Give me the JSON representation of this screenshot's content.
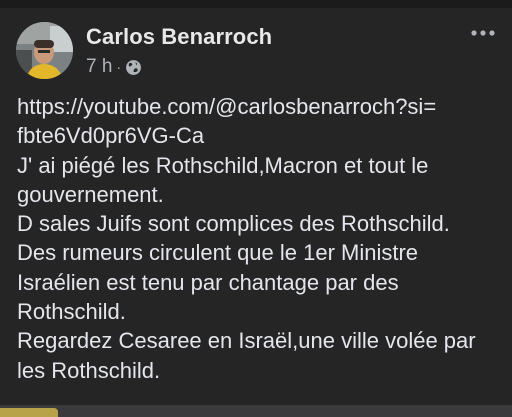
{
  "post": {
    "author": "Carlos Benarroch",
    "time": "7 h",
    "separator": "·",
    "audience_icon": "globe-icon",
    "more_icon": "more-options-icon",
    "lines": [
      "https://youtube.com/@carlosbenarroch?si=",
      "fbte6Vd0pr6VG-Ca",
      "J' ai piégé les Rothschild,Macron et tout le",
      "gouvernement.",
      "D sales Juifs sont complices des Rothschild.",
      "Des rumeurs circulent que le 1er Ministre",
      "Israélien est tenu par chantage par des",
      "Rothschild.",
      "Regardez Cesaree en Israël,une ville volée par",
      "les Rothschild."
    ]
  },
  "colors": {
    "background": "#252526",
    "text": "#e4e6eb",
    "secondary_text": "#b0b3b8"
  }
}
